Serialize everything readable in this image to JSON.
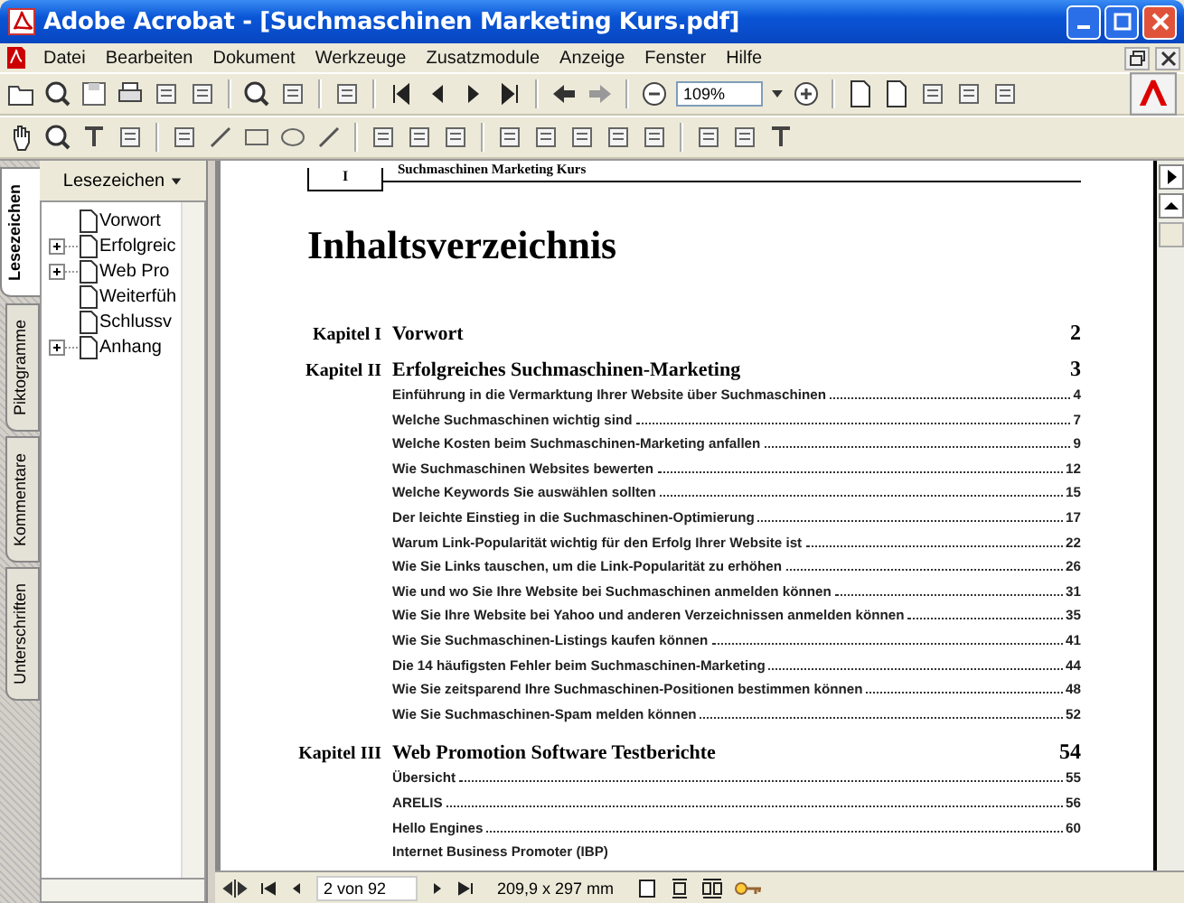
{
  "window": {
    "title": "Adobe Acrobat - [Suchmaschinen Marketing Kurs.pdf]"
  },
  "menu": [
    "Datei",
    "Bearbeiten",
    "Dokument",
    "Werkzeuge",
    "Zusatzmodule",
    "Anzeige",
    "Fenster",
    "Hilfe"
  ],
  "toolbar": {
    "zoom": "109%"
  },
  "side_tabs": [
    {
      "label": "Lesezeichen",
      "selected": true
    },
    {
      "label": "Piktogramme",
      "selected": false
    },
    {
      "label": "Kommentare",
      "selected": false
    },
    {
      "label": "Unterschriften",
      "selected": false
    }
  ],
  "bookmarks": {
    "header": "Lesezeichen",
    "items": [
      {
        "label": "Vorwort",
        "expandable": false
      },
      {
        "label": "Erfolgreic",
        "expandable": true
      },
      {
        "label": "Web Pro",
        "expandable": true
      },
      {
        "label": "Weiterfüh",
        "expandable": false
      },
      {
        "label": "Schlussv",
        "expandable": false
      },
      {
        "label": "Anhang",
        "expandable": true
      }
    ]
  },
  "document": {
    "header_number": "I",
    "header_title": "Suchmaschinen Marketing Kurs",
    "title": "Inhaltsverzeichnis",
    "chapters": [
      {
        "label": "Kapitel I",
        "title": "Vorwort",
        "page": "2"
      },
      {
        "label": "Kapitel II",
        "title": "Erfolgreiches Suchmaschinen-Marketing",
        "page": "3",
        "entries": [
          {
            "title": "Einführung in die Vermarktung Ihrer Website über Suchmaschinen",
            "page": "4"
          },
          {
            "title": "Welche Suchmaschinen wichtig sind",
            "page": "7"
          },
          {
            "title": "Welche Kosten beim Suchmaschinen-Marketing anfallen",
            "page": "9"
          },
          {
            "title": "Wie Suchmaschinen Websites bewerten",
            "page": "12"
          },
          {
            "title": "Welche Keywords Sie auswählen sollten",
            "page": "15"
          },
          {
            "title": "Der leichte Einstieg in die Suchmaschinen-Optimierung",
            "page": "17"
          },
          {
            "title": "Warum Link-Popularität wichtig für den Erfolg Ihrer Website ist",
            "page": "22"
          },
          {
            "title": "Wie Sie Links tauschen, um die Link-Popularität zu erhöhen",
            "page": "26"
          },
          {
            "title": "Wie und wo Sie Ihre Website bei Suchmaschinen anmelden können",
            "page": "31"
          },
          {
            "title": "Wie Sie Ihre Website bei Yahoo und anderen Verzeichnissen anmelden können",
            "page": "35"
          },
          {
            "title": "Wie Sie Suchmaschinen-Listings kaufen können",
            "page": "41"
          },
          {
            "title": "Die 14 häufigsten Fehler beim Suchmaschinen-Marketing",
            "page": "44"
          },
          {
            "title": "Wie Sie zeitsparend Ihre Suchmaschinen-Positionen bestimmen können",
            "page": "48"
          },
          {
            "title": "Wie Sie Suchmaschinen-Spam melden können",
            "page": "52"
          }
        ]
      },
      {
        "label": "Kapitel III",
        "title": "Web Promotion Software Testberichte",
        "page": "54",
        "entries": [
          {
            "title": "Übersicht",
            "page": "55"
          },
          {
            "title": "ARELIS",
            "page": "56"
          },
          {
            "title": "Hello Engines",
            "page": "60"
          },
          {
            "title": "Internet Business Promoter (IBP)"
          }
        ]
      }
    ]
  },
  "status_bar": {
    "page": "2 von 92",
    "size": "209,9 x 297 mm"
  }
}
